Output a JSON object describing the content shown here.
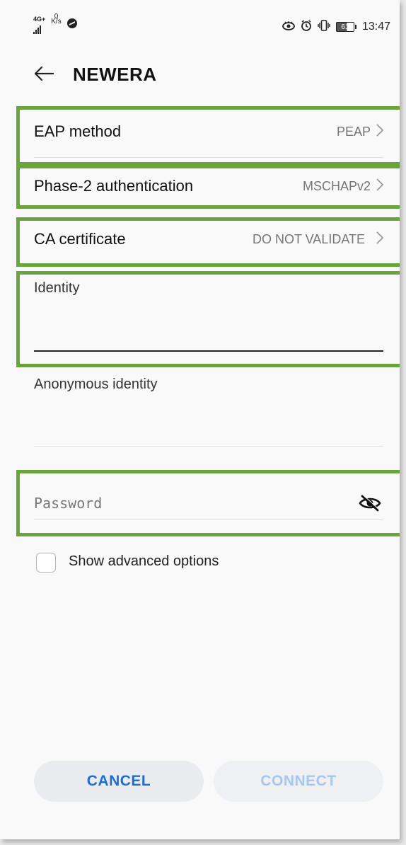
{
  "status_bar": {
    "network_type": "4G+",
    "data_speed_value": "0",
    "data_speed_unit": "K/s",
    "battery_level": "61",
    "time": "13:47",
    "icons": [
      "signal-icon",
      "messenger-icon",
      "eye-comfort-icon",
      "alarm-icon",
      "vibrate-icon",
      "battery-icon"
    ]
  },
  "header": {
    "back_icon": "arrow-left-icon",
    "title": "NEWERA"
  },
  "settings": {
    "eap_method": {
      "label": "EAP method",
      "value": "PEAP"
    },
    "phase2": {
      "label": "Phase-2 authentication",
      "value": "MSCHAPv2"
    },
    "ca_certificate": {
      "label": "CA certificate",
      "value": "DO NOT VALIDATE"
    },
    "identity": {
      "label": "Identity",
      "value": ""
    },
    "anonymous_identity": {
      "label": "Anonymous identity",
      "value": ""
    },
    "password": {
      "placeholder": "Password",
      "value": "",
      "toggle_icon": "eye-off-icon"
    },
    "advanced": {
      "label": "Show advanced options",
      "checked": false
    }
  },
  "buttons": {
    "cancel": "CANCEL",
    "connect": "CONNECT"
  },
  "colors": {
    "highlight": "#6aa43c",
    "primary_blue": "#1a6fd6",
    "disabled_blue": "#a9c6eb"
  }
}
